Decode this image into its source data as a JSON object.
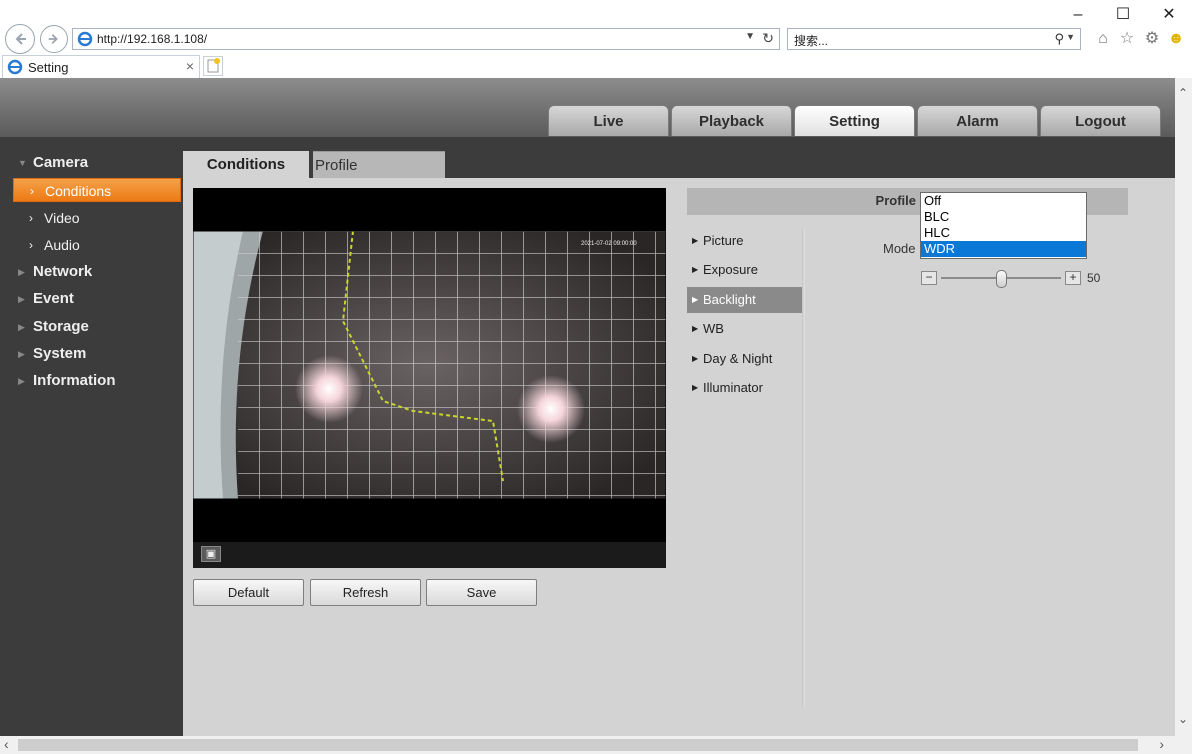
{
  "browser": {
    "url": "http://192.168.1.108/",
    "search_placeholder": "搜索...",
    "tab_title": "Setting"
  },
  "top_nav": [
    {
      "label": "Live",
      "active": false
    },
    {
      "label": "Playback",
      "active": false
    },
    {
      "label": "Setting",
      "active": true
    },
    {
      "label": "Alarm",
      "active": false
    },
    {
      "label": "Logout",
      "active": false
    }
  ],
  "sidebar": {
    "camera": "Camera",
    "sub": [
      {
        "label": "Conditions",
        "active": true
      },
      {
        "label": "Video",
        "active": false
      },
      {
        "label": "Audio",
        "active": false
      }
    ],
    "sections": [
      "Network",
      "Event",
      "Storage",
      "System",
      "Information"
    ]
  },
  "content_tabs": {
    "conditions": "Conditions",
    "profile_management": "Profile Management"
  },
  "video": {
    "timestamp": "2021-07-02 09:00:00"
  },
  "actions": {
    "default": "Default",
    "refresh": "Refresh",
    "save": "Save"
  },
  "profile_label": "Profile",
  "condition_menu": [
    {
      "label": "Picture",
      "active": false
    },
    {
      "label": "Exposure",
      "active": false
    },
    {
      "label": "Backlight",
      "active": true
    },
    {
      "label": "WB",
      "active": false
    },
    {
      "label": "Day & Night",
      "active": false
    },
    {
      "label": "Illuminator",
      "active": false
    }
  ],
  "mode": {
    "label": "Mode",
    "options": [
      "Off",
      "BLC",
      "HLC",
      "WDR"
    ],
    "selected": "WDR"
  },
  "wdr_slider": {
    "value": "50",
    "fraction": 0.5
  },
  "colors": {
    "active_orange": "#ec7a14",
    "select_blue": "#0a78d7",
    "sidebar_bg": "#3c3c3c"
  }
}
